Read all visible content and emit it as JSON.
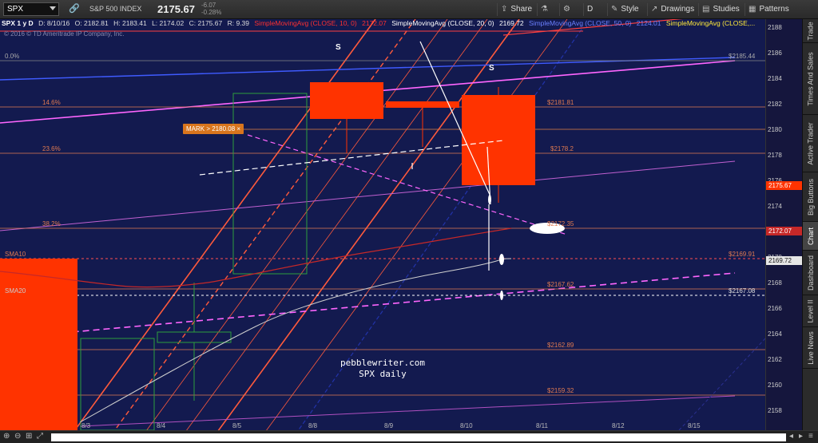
{
  "toolbar": {
    "symbol": "SPX",
    "index_name": "S&P 500 INDEX",
    "last_price": "2175.67",
    "change": "-6.07",
    "change_pct": "-0.28%",
    "buttons": [
      {
        "label": "Share",
        "icon": "share-icon"
      },
      {
        "label": "",
        "icon": "flask-icon"
      },
      {
        "label": "",
        "icon": "gear-icon"
      },
      {
        "label": "D",
        "icon": ""
      },
      {
        "label": "Style",
        "icon": "style-icon"
      },
      {
        "label": "Drawings",
        "icon": "pencil-icon"
      },
      {
        "label": "Studies",
        "icon": "studies-icon"
      },
      {
        "label": "Patterns",
        "icon": "patterns-icon"
      }
    ]
  },
  "info": {
    "timeframe": "SPX 1 y D",
    "date": "D: 8/10/16",
    "open": "O: 2182.81",
    "high": "H: 2183.41",
    "low": "L: 2174.02",
    "close": "C: 2175.67",
    "range": "R: 9.39",
    "sma10": "SimpleMovingAvg (CLOSE, 10, 0)",
    "sma10_val": "2172.07",
    "sma20": "SimpleMovingAvg (CLOSE, 20, 0)",
    "sma20_val": "2169.72",
    "sma50": "SimpleMovingAvg (CLOSE, 50, 0)",
    "sma50_val": "2124.01",
    "sma_more": "SimpleMovingAvg (CLOSE,...",
    "copyright": "© 2016 © TD Ameritrade IP Company, Inc."
  },
  "price_axis": {
    "ticks": [
      "2188",
      "2186",
      "2184",
      "2182",
      "2180",
      "2178",
      "2176",
      "2174",
      "2172",
      "2170",
      "2168",
      "2166",
      "2164",
      "2162",
      "2160",
      "2158"
    ],
    "badge_close": "2175.67",
    "badge_sma10": "2172.07",
    "badge_sma20": "2169.72"
  },
  "dates": [
    "8/3",
    "8/4",
    "8/5",
    "8/8",
    "8/9",
    "8/10",
    "8/11",
    "8/12",
    "8/15"
  ],
  "fib_levels": [
    "0.0%",
    "14.6%",
    "23.6%",
    "38.2%"
  ],
  "price_levels": [
    "$2185.44",
    "$2181.81",
    "$2178.2",
    "$2172.35",
    "$2169.91",
    "$2167.62",
    "$2167.08",
    "$2162.89",
    "$2159.32"
  ],
  "sma_labels": [
    "SMA10",
    "SMA20"
  ],
  "mark_tag": "MARK > 2180.08 ×",
  "s_labels": [
    "S",
    "S"
  ],
  "watermark": {
    "line1": "pebblewriter.com",
    "line2": "SPX daily"
  },
  "side_tabs": [
    "Trade",
    "Times And Sales",
    "Active Trader",
    "Big Buttons",
    "Chart",
    "Dashboard",
    "Level II",
    "Live News"
  ],
  "colors": {
    "background": "#131a4f",
    "candle": "#ff3300",
    "fib": "#e07a50",
    "sma10": "#c62828",
    "sma20": "#dddddd",
    "sma50": "#3f5bff",
    "channel": "#ff6f6f",
    "magenta": "#ff66ff"
  }
}
